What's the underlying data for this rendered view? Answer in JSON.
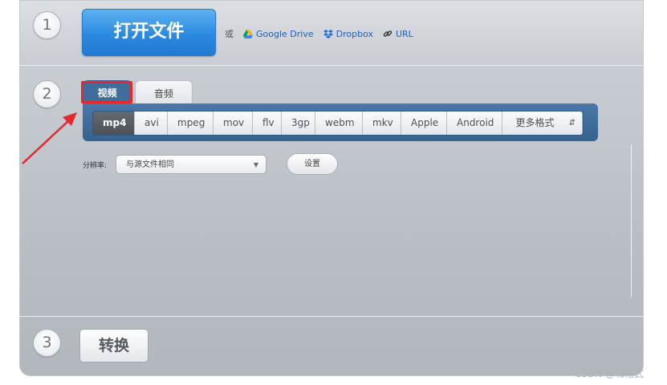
{
  "steps": {
    "one": "1",
    "two": "2",
    "three": "3"
  },
  "open_file": {
    "label": "打开文件"
  },
  "sources": {
    "or": "或",
    "google_drive": "Google Drive",
    "dropbox": "Dropbox",
    "url": "URL"
  },
  "tabs": [
    {
      "label": "视频",
      "active": true
    },
    {
      "label": "音频",
      "active": false
    }
  ],
  "formats": [
    {
      "label": "mp4",
      "active": true
    },
    {
      "label": "avi"
    },
    {
      "label": "mpeg"
    },
    {
      "label": "mov"
    },
    {
      "label": "flv"
    },
    {
      "label": "3gp"
    },
    {
      "label": "webm"
    },
    {
      "label": "mkv"
    },
    {
      "label": "Apple"
    },
    {
      "label": "Android"
    },
    {
      "label": "更多格式"
    }
  ],
  "resolution": {
    "label": "分辨率:",
    "value": "与源文件相同"
  },
  "settings_label": "设置",
  "convert_label": "转换",
  "watermark": "CSDN @嗨格式",
  "colors": {
    "primary": "#2b8ae0",
    "format_bar": "#3f6d9d",
    "highlight": "#e5282e"
  }
}
